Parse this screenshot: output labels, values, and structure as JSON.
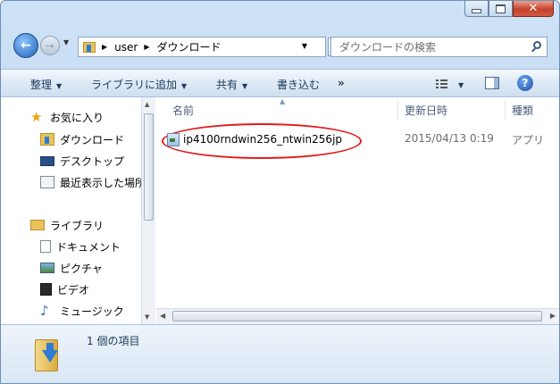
{
  "window": {
    "caption_buttons": {
      "minimize": "minimize-icon",
      "maximize": "maximize-icon",
      "close": "close-icon"
    }
  },
  "address": {
    "crumbs": [
      "user",
      "ダウンロード"
    ]
  },
  "search": {
    "placeholder": "ダウンロードの検索"
  },
  "toolbar": {
    "organize": "整理",
    "library": "ライブラリに追加",
    "share": "共有",
    "burn": "書き込む",
    "more": "»"
  },
  "sidebar": {
    "favorites": "お気に入り",
    "fav_items": [
      "ダウンロード",
      "デスクトップ",
      "最近表示した場所"
    ],
    "libraries": "ライブラリ",
    "lib_items": [
      "ドキュメント",
      "ピクチャ",
      "ビデオ",
      "ミュージック"
    ]
  },
  "columns": {
    "name": "名前",
    "date": "更新日時",
    "type": "種類"
  },
  "files": [
    {
      "name": "ip4100rndwin256_ntwin256jp",
      "date": "2015/04/13 0:19",
      "type": "アプリ"
    }
  ],
  "status": {
    "count": "1 個の項目"
  },
  "colors": {
    "annotation_ring": "#e01b1b",
    "accent": "#1e395b"
  }
}
